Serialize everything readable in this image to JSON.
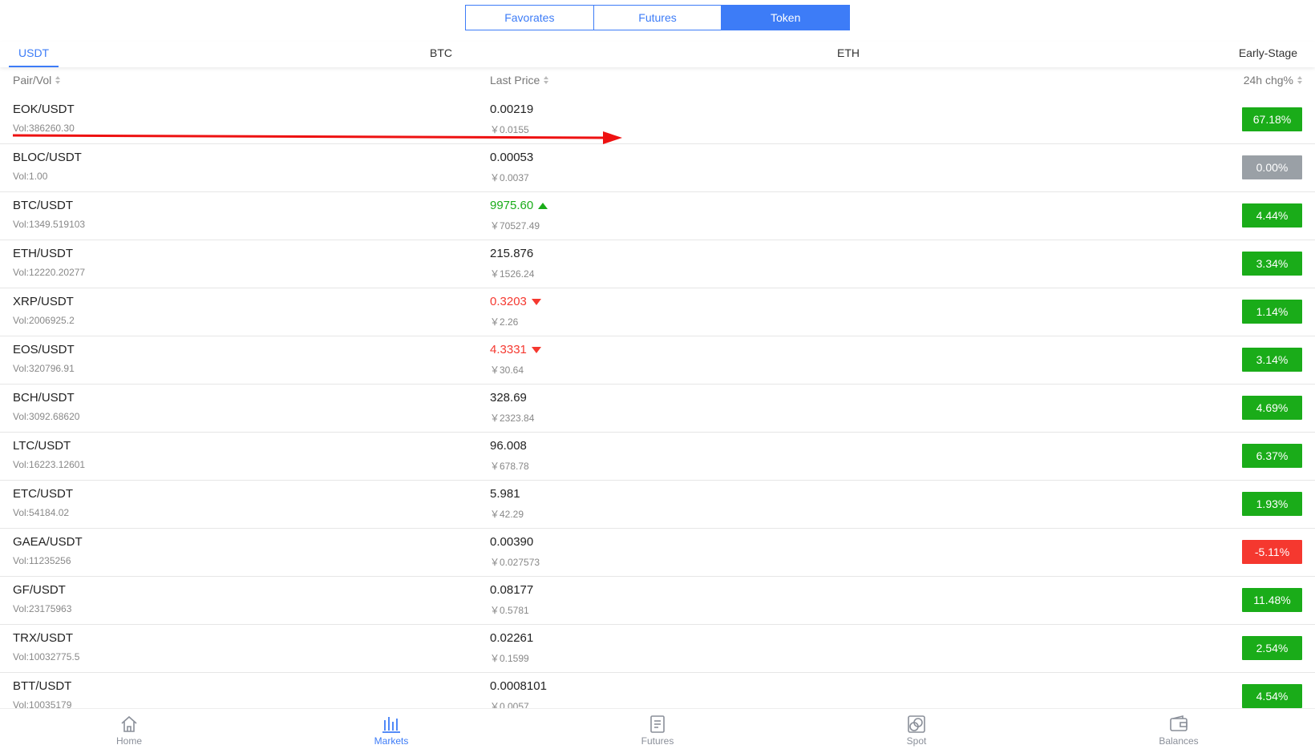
{
  "segment": {
    "tabs": [
      {
        "label": "Favorates",
        "active": false
      },
      {
        "label": "Futures",
        "active": false
      },
      {
        "label": "Token",
        "active": true
      }
    ]
  },
  "quote_tabs": [
    {
      "label": "USDT",
      "active": true
    },
    {
      "label": "BTC",
      "active": false
    },
    {
      "label": "ETH",
      "active": false
    },
    {
      "label": "Early-Stage",
      "active": false
    }
  ],
  "columns": {
    "pair_vol": "Pair/Vol",
    "last_price": "Last Price",
    "change": "24h chg%"
  },
  "rows": [
    {
      "pair": "EOK/USDT",
      "vol": "Vol:386260.30",
      "price": "0.00219",
      "trend": "none",
      "cny": "￥0.0155",
      "chg": "67.18%",
      "chg_status": "up"
    },
    {
      "pair": "BLOC/USDT",
      "vol": "Vol:1.00",
      "price": "0.00053",
      "trend": "none",
      "cny": "￥0.0037",
      "chg": "0.00%",
      "chg_status": "flat"
    },
    {
      "pair": "BTC/USDT",
      "vol": "Vol:1349.519103",
      "price": "9975.60",
      "trend": "up",
      "cny": "￥70527.49",
      "chg": "4.44%",
      "chg_status": "up"
    },
    {
      "pair": "ETH/USDT",
      "vol": "Vol:12220.20277",
      "price": "215.876",
      "trend": "none",
      "cny": "￥1526.24",
      "chg": "3.34%",
      "chg_status": "up"
    },
    {
      "pair": "XRP/USDT",
      "vol": "Vol:2006925.2",
      "price": "0.3203",
      "trend": "down",
      "cny": "￥2.26",
      "chg": "1.14%",
      "chg_status": "up"
    },
    {
      "pair": "EOS/USDT",
      "vol": "Vol:320796.91",
      "price": "4.3331",
      "trend": "down",
      "cny": "￥30.64",
      "chg": "3.14%",
      "chg_status": "up"
    },
    {
      "pair": "BCH/USDT",
      "vol": "Vol:3092.68620",
      "price": "328.69",
      "trend": "none",
      "cny": "￥2323.84",
      "chg": "4.69%",
      "chg_status": "up"
    },
    {
      "pair": "LTC/USDT",
      "vol": "Vol:16223.12601",
      "price": "96.008",
      "trend": "none",
      "cny": "￥678.78",
      "chg": "6.37%",
      "chg_status": "up"
    },
    {
      "pair": "ETC/USDT",
      "vol": "Vol:54184.02",
      "price": "5.981",
      "trend": "none",
      "cny": "￥42.29",
      "chg": "1.93%",
      "chg_status": "up"
    },
    {
      "pair": "GAEA/USDT",
      "vol": "Vol:11235256",
      "price": "0.00390",
      "trend": "none",
      "cny": "￥0.027573",
      "chg": "-5.11%",
      "chg_status": "down"
    },
    {
      "pair": "GF/USDT",
      "vol": "Vol:23175963",
      "price": "0.08177",
      "trend": "none",
      "cny": "￥0.5781",
      "chg": "11.48%",
      "chg_status": "up"
    },
    {
      "pair": "TRX/USDT",
      "vol": "Vol:10032775.5",
      "price": "0.02261",
      "trend": "none",
      "cny": "￥0.1599",
      "chg": "2.54%",
      "chg_status": "up"
    },
    {
      "pair": "BTT/USDT",
      "vol": "Vol:10035179",
      "price": "0.0008101",
      "trend": "none",
      "cny": "￥0.0057",
      "chg": "4.54%",
      "chg_status": "up"
    }
  ],
  "nav": [
    {
      "label": "Home",
      "icon": "home-icon",
      "active": false
    },
    {
      "label": "Markets",
      "icon": "markets-icon",
      "active": true
    },
    {
      "label": "Futures",
      "icon": "futures-icon",
      "active": false
    },
    {
      "label": "Spot",
      "icon": "spot-icon",
      "active": false
    },
    {
      "label": "Balances",
      "icon": "wallet-icon",
      "active": false
    }
  ],
  "colors": {
    "accent": "#3d7cf7",
    "up": "#1aac19",
    "down": "#f5382f",
    "flat": "#9aa0a6",
    "annotation": "#ee1111"
  }
}
